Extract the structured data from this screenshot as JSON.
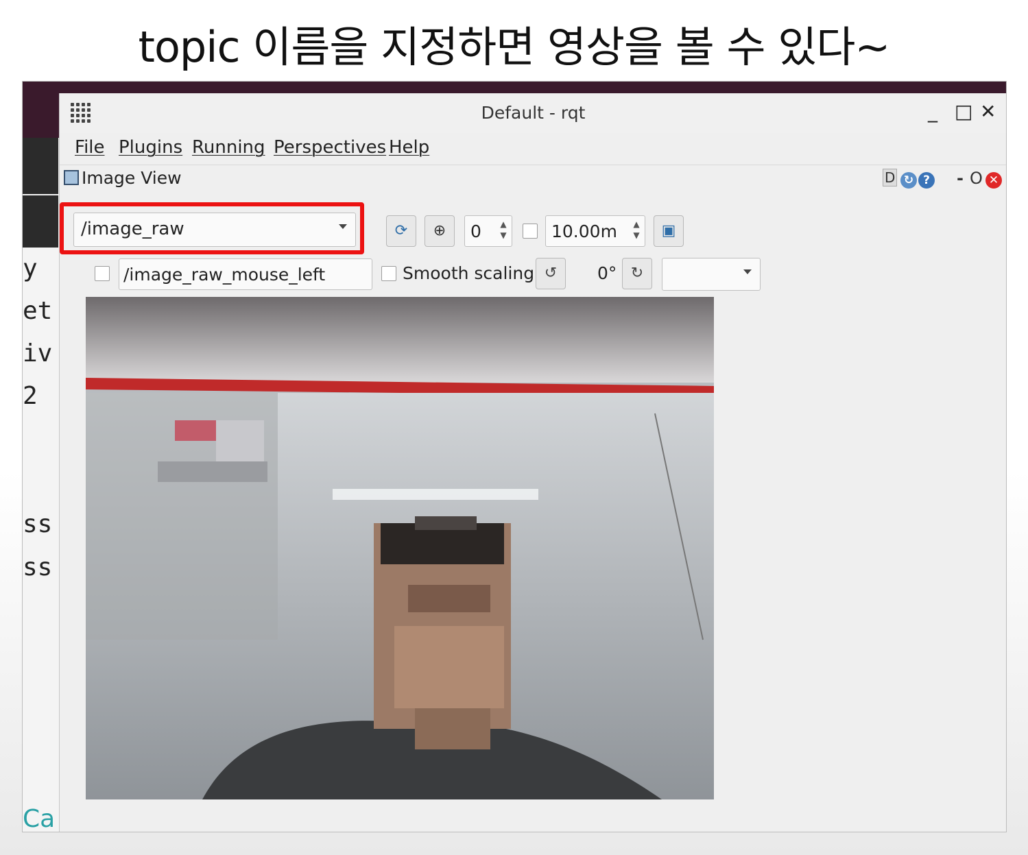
{
  "caption": "topic 이름을 지정하면 영상을 볼 수 있다~",
  "terminal": {
    "lines": [
      "y",
      "et",
      "iv",
      "2",
      "ss",
      "ss"
    ],
    "link": "Ca"
  },
  "window": {
    "title": "Default - rqt",
    "controls": [
      "_",
      "□",
      "✕"
    ]
  },
  "menu": {
    "items": [
      "File",
      "Plugins",
      "Running",
      "Perspectives",
      "Help"
    ]
  },
  "plugin": {
    "title": "Image View",
    "header_controls": {
      "d": "D",
      "dash": "-",
      "o": "O",
      "close": "✕"
    }
  },
  "toolbar": {
    "topic": "/image_raw",
    "zoom_value": "0",
    "timeout_value": "10.00m",
    "mouse_topic": "/image_raw_mouse_left",
    "smooth_label": "Smooth scaling",
    "rotation": "0°",
    "dropdown_value": ""
  },
  "colors": {
    "highlight": "#ec1212",
    "desktop_topbar": "#3a1a2c",
    "link": "#2aa1a5"
  },
  "icons": {
    "app_menu": "grid-icon",
    "refresh": "refresh-icon",
    "zoom": "zoom-icon",
    "save": "save-icon",
    "rotate_left": "rotate-left-icon",
    "rotate_right": "rotate-right-icon"
  }
}
